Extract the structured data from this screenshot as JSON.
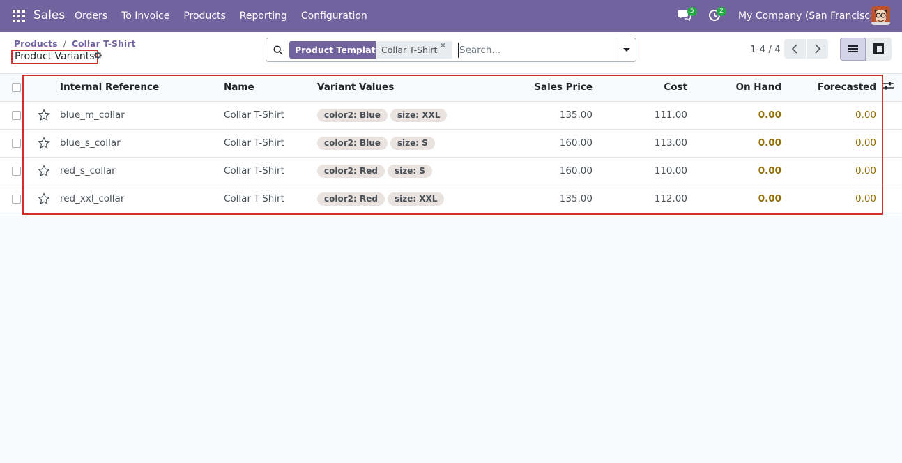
{
  "navbar": {
    "app_name": "Sales",
    "menu": [
      "Orders",
      "To Invoice",
      "Products",
      "Reporting",
      "Configuration"
    ],
    "messages_count": "5",
    "activities_count": "2",
    "company": "My Company (San Francisco)"
  },
  "breadcrumb": {
    "parent": "Products",
    "current": "Collar T-Shirt"
  },
  "page_title": "Product Variants",
  "search": {
    "facet_label": "Product Template",
    "facet_value": "Collar T-Shirt",
    "facet_close": "×",
    "placeholder": "Search..."
  },
  "pager": {
    "value": "1-4 / 4"
  },
  "table": {
    "columns": {
      "internal_reference": "Internal Reference",
      "name": "Name",
      "variant_values": "Variant Values",
      "sales_price": "Sales Price",
      "cost": "Cost",
      "on_hand": "On Hand",
      "forecasted": "Forecasted"
    },
    "rows": [
      {
        "ref": "blue_m_collar",
        "name": "Collar T-Shirt",
        "tags": [
          "color2: Blue",
          "size: XXL"
        ],
        "price": "135.00",
        "cost": "111.00",
        "on_hand": "0.00",
        "forecasted": "0.00"
      },
      {
        "ref": "blue_s_collar",
        "name": "Collar T-Shirt",
        "tags": [
          "color2: Blue",
          "size: S"
        ],
        "price": "160.00",
        "cost": "113.00",
        "on_hand": "0.00",
        "forecasted": "0.00"
      },
      {
        "ref": "red_s_collar",
        "name": "Collar T-Shirt",
        "tags": [
          "color2: Red",
          "size: S"
        ],
        "price": "160.00",
        "cost": "110.00",
        "on_hand": "0.00",
        "forecasted": "0.00"
      },
      {
        "ref": "red_xxl_collar",
        "name": "Collar T-Shirt",
        "tags": [
          "color2: Red",
          "size: XXL"
        ],
        "price": "135.00",
        "cost": "112.00",
        "on_hand": "0.00",
        "forecasted": "0.00"
      }
    ]
  },
  "colors": {
    "navbar": "#71639e",
    "highlight": "#d32f2f",
    "warning_text": "#946d04"
  }
}
